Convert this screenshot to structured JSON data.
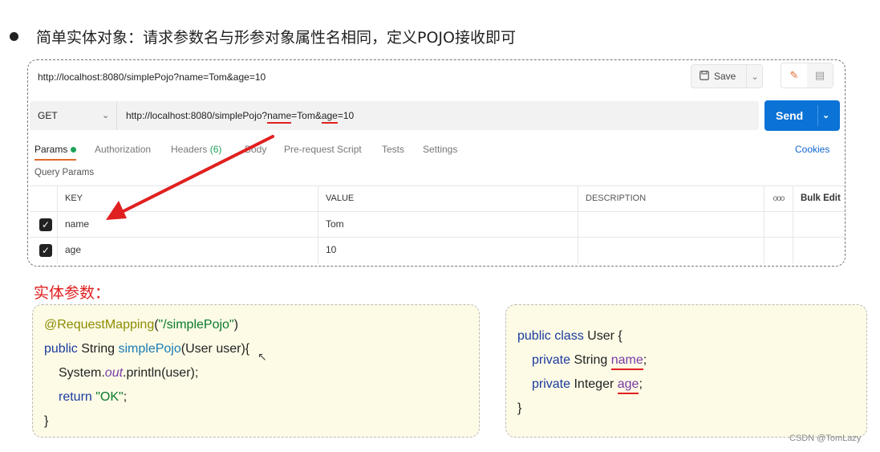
{
  "heading": {
    "text": "简单实体对象：请求参数名与形参对象属性名相同，定义POJO接收即可"
  },
  "postman": {
    "tab_url": "http://localhost:8080/simplePojo?name=Tom&age=10",
    "save_label": "Save",
    "method": "GET",
    "url": {
      "prefix": "http://localhost:8080/simplePojo?",
      "p1_key": "name",
      "p1_rest": "=Tom&",
      "p2_key": "age",
      "p2_rest": "=10"
    },
    "send_label": "Send",
    "tabs": [
      {
        "label": "Params",
        "active": true
      },
      {
        "label": "Authorization"
      },
      {
        "label": "Headers",
        "count": "(6)"
      },
      {
        "label": "Body"
      },
      {
        "label": "Pre-request Script"
      },
      {
        "label": "Tests"
      },
      {
        "label": "Settings"
      }
    ],
    "cookies_label": "Cookies",
    "query_params_label": "Query Params",
    "table": {
      "headers": {
        "key": "KEY",
        "value": "VALUE",
        "description": "DESCRIPTION",
        "more": "ooo",
        "bulk_edit": "Bulk Edit"
      },
      "rows": [
        {
          "key": "name",
          "value": "Tom",
          "checked": true
        },
        {
          "key": "age",
          "value": "10",
          "checked": true
        }
      ]
    },
    "colors": {
      "send": "#0b72d6",
      "active_tab": "#e0692b",
      "dot": "#1fa35a",
      "arrow": "#e02020"
    }
  },
  "entity_label": "实体参数：",
  "code_left": {
    "l1_ann": "@RequestMapping",
    "l1_paren_open": "(",
    "l1_str": "\"/simplePojo\"",
    "l1_paren_close": ")",
    "l2_kw": "public",
    "l2_type": " String ",
    "l2_fn": "simplePojo",
    "l2_rest": "(User user){",
    "l3_a": "System.",
    "l3_out": "out",
    "l3_b": ".println(user);",
    "l4_kw": "return",
    "l4_str": " \"OK\"",
    "l4_end": ";",
    "l5": "}"
  },
  "code_right": {
    "l1_kw": "public class",
    "l1_rest": " User {",
    "l2_kw": "private",
    "l2_type": " String ",
    "l2_field": "name",
    "l2_end": ";",
    "l3_kw": "private",
    "l3_type": " Integer ",
    "l3_field": "age",
    "l3_end": ";",
    "l4": "}"
  },
  "watermark": "CSDN @TomLazy"
}
